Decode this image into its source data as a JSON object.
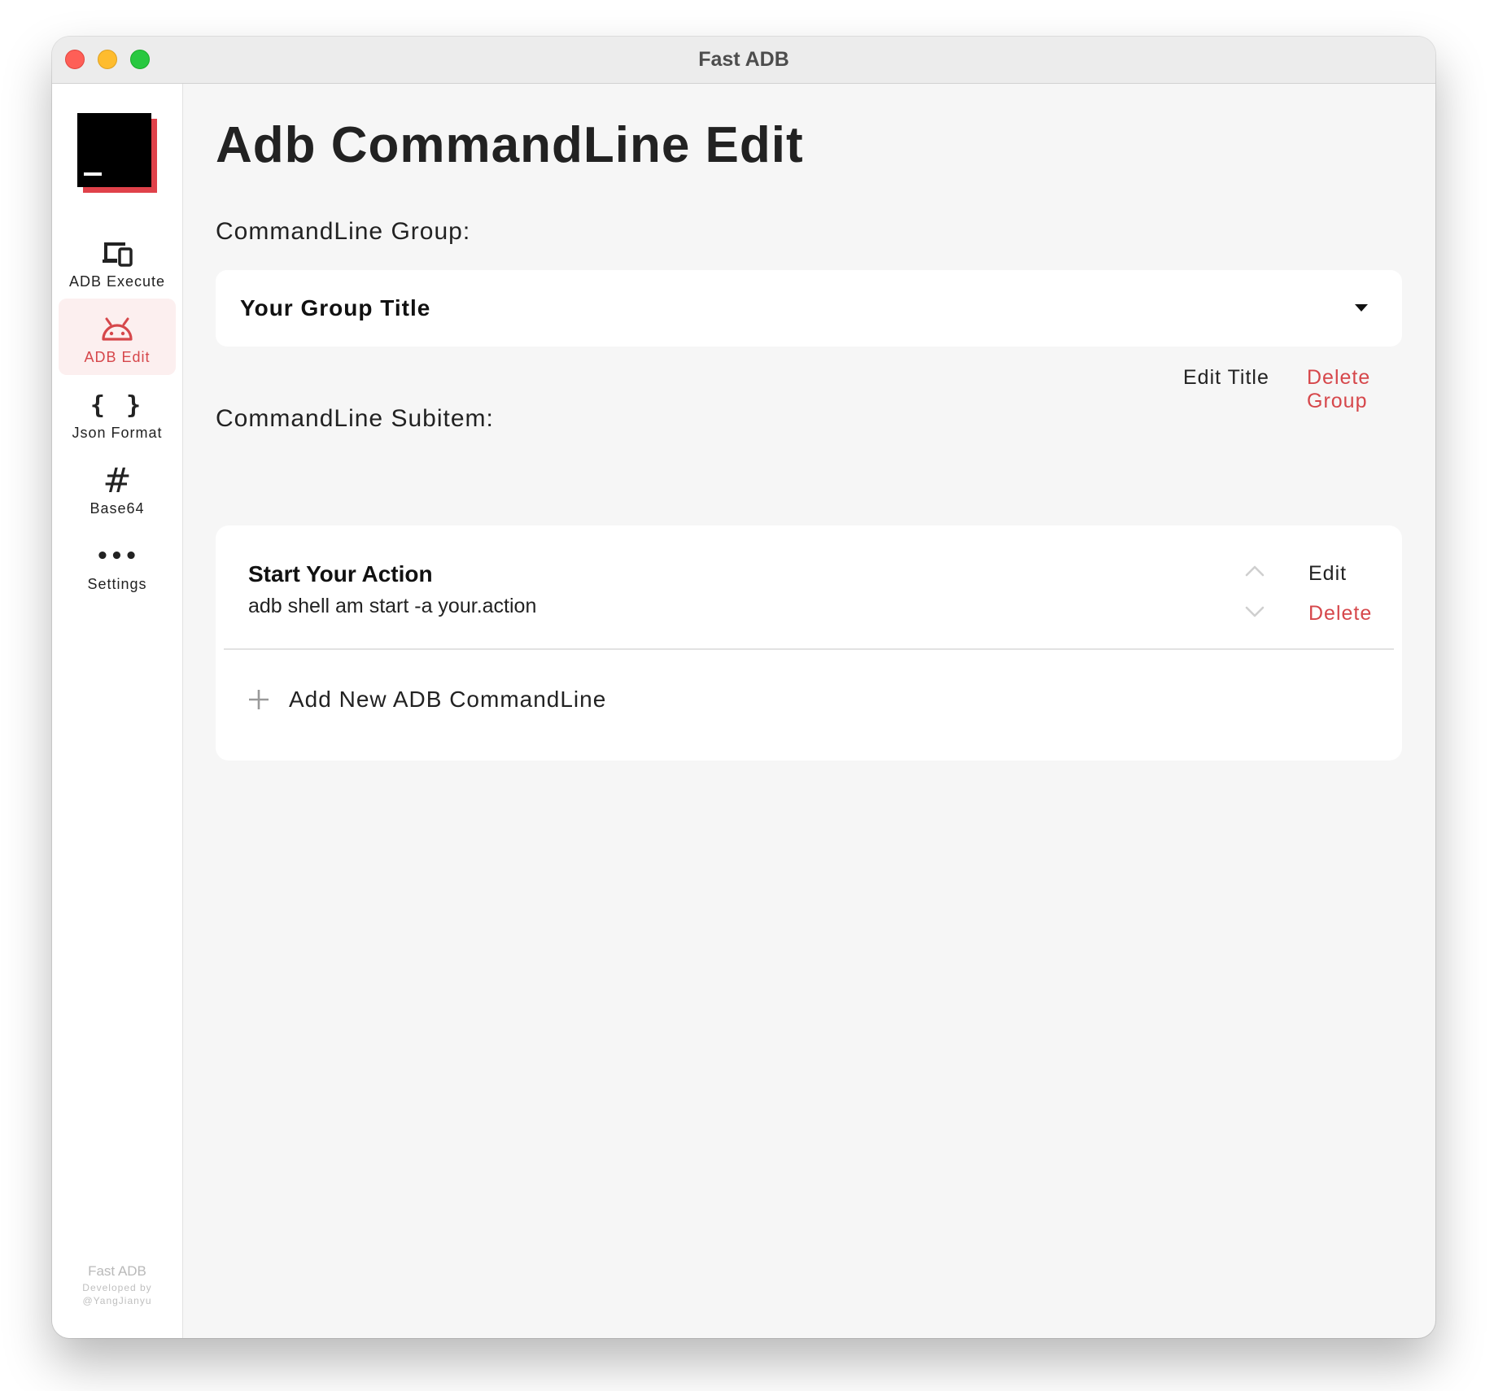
{
  "window": {
    "title": "Fast ADB"
  },
  "sidebar": {
    "items": [
      {
        "label": "ADB Execute",
        "icon": "devices-icon",
        "active": false
      },
      {
        "label": "ADB Edit",
        "icon": "android-icon",
        "active": true
      },
      {
        "label": "Json Format",
        "icon": "braces-icon",
        "glyph": "{ }",
        "active": false
      },
      {
        "label": "Base64",
        "icon": "hash-icon",
        "glyph": "#",
        "active": false
      },
      {
        "label": "Settings",
        "icon": "more-icon",
        "glyph": "•••",
        "active": false
      }
    ],
    "footer": {
      "app_name": "Fast ADB",
      "credit_line1": "Developed by",
      "credit_line2": "@YangJianyu"
    }
  },
  "main": {
    "page_title": "Adb CommandLine Edit",
    "group_label": "CommandLine Group:",
    "group_select": {
      "selected": "Your Group Title"
    },
    "group_actions": {
      "edit_title": "Edit Title",
      "delete_group": "Delete Group"
    },
    "subitem_label": "CommandLine Subitem:",
    "subitems": [
      {
        "title": "Start Your Action",
        "command": "adb shell am start -a your.action",
        "edit_label": "Edit",
        "delete_label": "Delete"
      }
    ],
    "add_label": "Add New ADB CommandLine"
  },
  "colors": {
    "accent": "#d6474b",
    "background": "#f6f6f6",
    "card": "#ffffff",
    "active_nav_bg": "#fcefef"
  }
}
